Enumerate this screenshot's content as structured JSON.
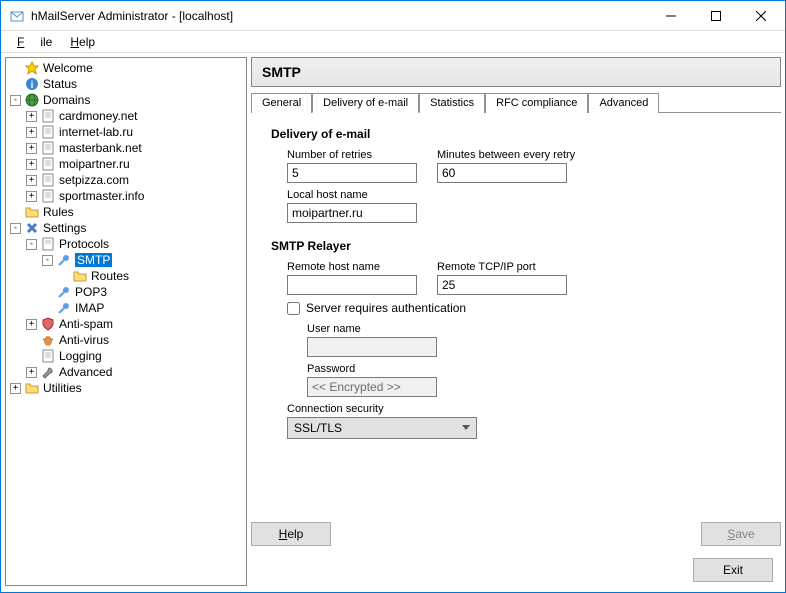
{
  "window": {
    "title": "hMailServer Administrator - [localhost]"
  },
  "menubar": {
    "file": "File",
    "help": "Help"
  },
  "tree": {
    "welcome": "Welcome",
    "status": "Status",
    "domains": "Domains",
    "domain_list": [
      "cardmoney.net",
      "internet-lab.ru",
      "masterbank.net",
      "moipartner.ru",
      "setpizza.com",
      "sportmaster.info"
    ],
    "rules": "Rules",
    "settings": "Settings",
    "protocols": "Protocols",
    "smtp": "SMTP",
    "routes": "Routes",
    "pop3": "POP3",
    "imap": "IMAP",
    "antispam": "Anti-spam",
    "antivirus": "Anti-virus",
    "logging": "Logging",
    "advanced": "Advanced",
    "utilities": "Utilities"
  },
  "panel": {
    "title": "SMTP",
    "tabs": {
      "general": "General",
      "delivery": "Delivery of e-mail",
      "statistics": "Statistics",
      "rfc": "RFC compliance",
      "advanced": "Advanced"
    },
    "section_delivery": "Delivery of e-mail",
    "retries_label": "Number of retries",
    "retries_value": "5",
    "minutes_label": "Minutes between every retry",
    "minutes_value": "60",
    "localhost_label": "Local host name",
    "localhost_value": "moipartner.ru",
    "section_relayer": "SMTP Relayer",
    "remotehost_label": "Remote host name",
    "remotehost_value": "",
    "remoteport_label": "Remote TCP/IP port",
    "remoteport_value": "25",
    "auth_label": "Server requires authentication",
    "username_label": "User name",
    "username_value": "",
    "password_label": "Password",
    "password_value": "<< Encrypted >>",
    "connsec_label": "Connection security",
    "connsec_value": "SSL/TLS"
  },
  "buttons": {
    "help": "Help",
    "save": "Save",
    "exit": "Exit"
  }
}
